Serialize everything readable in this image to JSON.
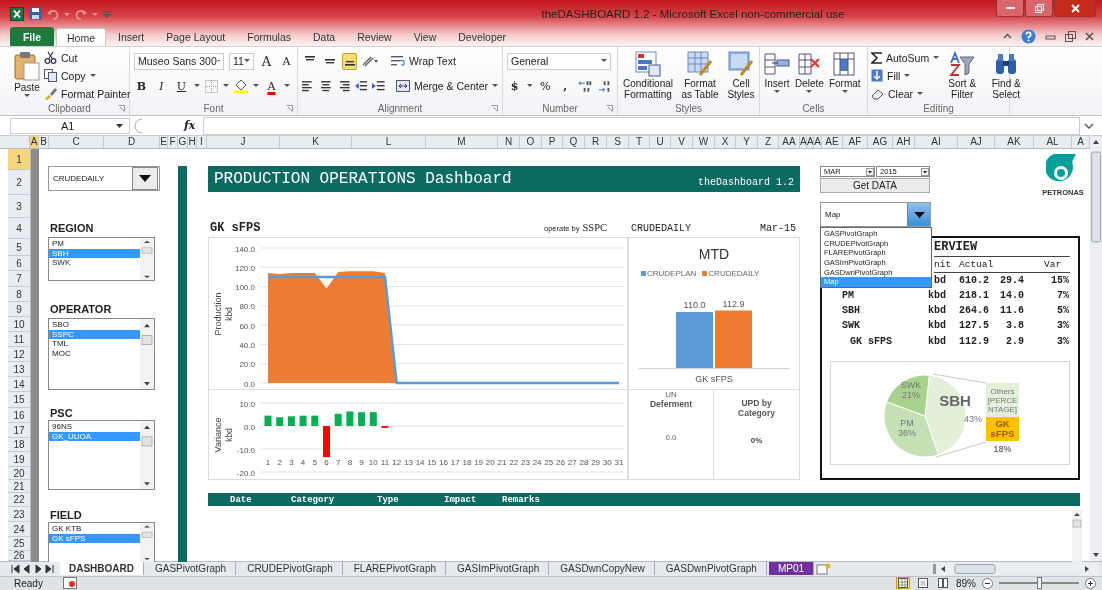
{
  "window": {
    "title": "theDASHBOARD 1.2  -  Microsoft Excel non-commercial use"
  },
  "ribbon_tabs": [
    {
      "label": "File",
      "kind": "file",
      "selected": false
    },
    {
      "label": "Home",
      "kind": "tab",
      "selected": true
    },
    {
      "label": "Insert",
      "kind": "tab",
      "selected": false
    },
    {
      "label": "Page Layout",
      "kind": "tab",
      "selected": false
    },
    {
      "label": "Formulas",
      "kind": "tab",
      "selected": false
    },
    {
      "label": "Data",
      "kind": "tab",
      "selected": false
    },
    {
      "label": "Review",
      "kind": "tab",
      "selected": false
    },
    {
      "label": "View",
      "kind": "tab",
      "selected": false
    },
    {
      "label": "Developer",
      "kind": "tab",
      "selected": false
    }
  ],
  "clipboard": {
    "group": "Clipboard",
    "paste": "Paste",
    "cut": "Cut",
    "copy": "Copy",
    "format_painter": "Format Painter"
  },
  "font": {
    "group": "Font",
    "name": "Museo Sans 300",
    "size": "11",
    "grow": "A",
    "shrink": "A",
    "bold": "B",
    "italic": "I",
    "underline": "U",
    "font_color": "A"
  },
  "alignment": {
    "group": "Alignment",
    "wrap": "Wrap Text",
    "merge": "Merge & Center",
    "vertical": [
      {
        "kind": "top",
        "on": false
      },
      {
        "kind": "middle",
        "on": false
      },
      {
        "kind": "bottom",
        "on": true
      }
    ]
  },
  "number": {
    "group": "Number",
    "format": "General",
    "currency": "$",
    "percent": "%",
    "comma": ","
  },
  "styles": {
    "group": "Styles",
    "buttons": [
      {
        "kind": "conditional",
        "label": "Conditional Formatting"
      },
      {
        "kind": "table",
        "label": "Format as Table"
      },
      {
        "kind": "cell",
        "label": "Cell Styles"
      }
    ]
  },
  "cells": {
    "group": "Cells",
    "buttons": [
      {
        "kind": "insert",
        "label": "Insert"
      },
      {
        "kind": "delete",
        "label": "Delete"
      },
      {
        "kind": "format",
        "label": "Format"
      }
    ]
  },
  "editing": {
    "group": "Editing",
    "autosum": "AutoSum",
    "fill": "Fill",
    "clear": "Clear",
    "sort": "Sort & Filter",
    "find": "Find & Select"
  },
  "formula_bar": {
    "name_box": "A1",
    "function_label": "fx"
  },
  "columns": [
    {
      "label": "A",
      "active": true
    },
    {
      "label": "B",
      "active": false
    },
    {
      "label": "C",
      "active": false
    },
    {
      "label": "D",
      "active": false
    },
    {
      "label": "E",
      "active": false
    },
    {
      "label": "F",
      "active": false
    },
    {
      "label": "G",
      "active": false
    },
    {
      "label": "H",
      "active": false
    },
    {
      "label": "I",
      "active": false
    },
    {
      "label": "J",
      "active": false
    },
    {
      "label": "K",
      "active": false
    },
    {
      "label": "L",
      "active": false
    },
    {
      "label": "M",
      "active": false
    },
    {
      "label": "N",
      "active": false
    },
    {
      "label": "O",
      "active": false
    },
    {
      "label": "P",
      "active": false
    },
    {
      "label": "Q",
      "active": false
    },
    {
      "label": "R",
      "active": false
    },
    {
      "label": "S",
      "active": false
    },
    {
      "label": "T",
      "active": false
    },
    {
      "label": "U",
      "active": false
    },
    {
      "label": "V",
      "active": false
    },
    {
      "label": "W",
      "active": false
    },
    {
      "label": "X",
      "active": false
    },
    {
      "label": "Y",
      "active": false
    },
    {
      "label": "Z",
      "active": false
    },
    {
      "label": "AA",
      "active": false
    },
    {
      "label": "A",
      "active": false
    },
    {
      "label": "A",
      "active": false
    },
    {
      "label": "A",
      "active": false
    },
    {
      "label": "AE",
      "active": false
    },
    {
      "label": "AF",
      "active": false
    },
    {
      "label": "AG",
      "active": false
    },
    {
      "label": "AH",
      "active": false
    },
    {
      "label": "AI",
      "active": false
    },
    {
      "label": "AJ",
      "active": false
    },
    {
      "label": "AK",
      "active": false
    },
    {
      "label": "AL",
      "active": false
    },
    {
      "label": "A",
      "active": false
    }
  ],
  "rows": [
    {
      "label": "1",
      "active": true
    },
    {
      "label": "2",
      "active": false
    },
    {
      "label": "3",
      "active": false
    },
    {
      "label": "4",
      "active": false
    },
    {
      "label": "5",
      "active": false
    },
    {
      "label": "6",
      "active": false
    },
    {
      "label": "7",
      "active": false
    },
    {
      "label": "8",
      "active": false
    },
    {
      "label": "9",
      "active": false
    },
    {
      "label": "10",
      "active": false
    },
    {
      "label": "11",
      "active": false
    },
    {
      "label": "12",
      "active": false
    },
    {
      "label": "13",
      "active": false
    },
    {
      "label": "14",
      "active": false
    },
    {
      "label": "15",
      "active": false
    },
    {
      "label": "16",
      "active": false
    },
    {
      "label": "17",
      "active": false
    },
    {
      "label": "18",
      "active": false
    },
    {
      "label": "19",
      "active": false
    },
    {
      "label": "20",
      "active": false
    },
    {
      "label": "21",
      "active": false
    },
    {
      "label": "22",
      "active": false
    },
    {
      "label": "23",
      "active": false
    },
    {
      "label": "24",
      "active": false
    },
    {
      "label": "25",
      "active": false
    },
    {
      "label": "26",
      "active": false
    }
  ],
  "sheet": {
    "selector": {
      "value": "CRUDEDAILY"
    },
    "filters": [
      {
        "label": "REGION",
        "items": [
          {
            "label": "PM",
            "selected": false
          },
          {
            "label": "SBH",
            "selected": true
          },
          {
            "label": "SWK",
            "selected": false
          }
        ]
      },
      {
        "label": "OPERATOR",
        "items": [
          {
            "label": "SBO",
            "selected": false
          },
          {
            "label": "SSPC",
            "selected": true
          },
          {
            "label": "TML",
            "selected": false
          },
          {
            "label": "MOC",
            "selected": false
          }
        ]
      },
      {
        "label": "PSC",
        "items": [
          {
            "label": "96NS",
            "selected": false
          },
          {
            "label": "GK_UUOA",
            "selected": true
          }
        ]
      },
      {
        "label": "FIELD",
        "items": [
          {
            "label": "GK KTB",
            "selected": false
          },
          {
            "label": "GK sFPS",
            "selected": true
          }
        ]
      }
    ],
    "banner": {
      "title": "PRODUCTION OPERATIONS Dashboard",
      "version": "theDashboard 1.2"
    },
    "field_title": "GK sFPS",
    "operator_label": "operate by",
    "operator": "SSPC",
    "measure": "CRUDEDAILY",
    "period": "Mar-15",
    "production_chart": {
      "unit": "kbd",
      "chart_data": {
        "type": "area",
        "ylabel": "Production",
        "ylim": [
          0,
          140
        ],
        "grid": true,
        "yticks": [
          {
            "value": 0,
            "label": "0.0"
          },
          {
            "value": 20,
            "label": "20.0"
          },
          {
            "value": 40,
            "label": "40.0"
          },
          {
            "value": 60,
            "label": "60.0"
          },
          {
            "value": 80,
            "label": "80.0"
          },
          {
            "value": 100,
            "label": "100.0"
          },
          {
            "value": 120,
            "label": "120.0"
          },
          {
            "value": 140,
            "label": "140.0"
          }
        ],
        "series": [
          {
            "type": "area",
            "color": "#ed7d31",
            "values": [
              114,
              113,
              114,
              114,
              114,
              98,
              115,
              116,
              116,
              116,
              114,
              0,
              0,
              0,
              0,
              0,
              0,
              0,
              0,
              0,
              0,
              0,
              0,
              0,
              0,
              0,
              0,
              0,
              0,
              0,
              0
            ]
          },
          {
            "type": "line",
            "color": "#5b9bd5",
            "values": [
              110,
              110,
              110,
              110,
              110,
              110,
              110,
              110,
              110,
              110,
              110,
              0,
              0,
              0,
              0,
              0,
              0,
              0,
              0,
              0,
              0,
              0,
              0,
              0,
              0,
              0,
              0,
              0,
              0,
              0,
              0
            ]
          }
        ]
      }
    },
    "variance_chart": {
      "unit": "kbd",
      "chart_data": {
        "type": "bar",
        "ylabel": "Variance",
        "stacked": true,
        "grid": true,
        "x": [
          1,
          2,
          3,
          4,
          5,
          6,
          7,
          8,
          9,
          10,
          11,
          12,
          13,
          14,
          15,
          16,
          17,
          18,
          19,
          20,
          21,
          22,
          23,
          24,
          25,
          26,
          27,
          28,
          29,
          30,
          31
        ],
        "ylim": [
          -20,
          10
        ],
        "yticks": [
          {
            "value": -20,
            "label": "-20.0"
          },
          {
            "value": -10,
            "label": "-10.0"
          },
          {
            "value": 0,
            "label": "0.0"
          },
          {
            "value": 10,
            "label": "10.0"
          }
        ],
        "series": [
          {
            "color": "#00b050",
            "values": [
              4.5,
              3.8,
              4.2,
              4.5,
              4.5,
              null,
              5.3,
              6.3,
              6,
              6,
              null,
              null,
              null,
              null,
              null,
              null,
              null,
              null,
              null,
              null,
              null,
              null,
              null,
              null,
              null,
              null,
              null,
              null,
              null,
              null,
              null
            ]
          },
          {
            "color": "#ff0000",
            "values": [
              null,
              null,
              null,
              null,
              null,
              -13.5,
              null,
              null,
              null,
              null,
              -0.8,
              null,
              null,
              null,
              null,
              null,
              null,
              null,
              null,
              null,
              null,
              null,
              null,
              null,
              null,
              null,
              null,
              null,
              null,
              null,
              null
            ]
          }
        ]
      }
    },
    "mtd_chart": {
      "chart_data": {
        "type": "bar",
        "title": "MTD",
        "categories": [
          "GK sFPS"
        ],
        "series": [
          {
            "name": "CRUDEPLAN",
            "color": "#5b9bd5",
            "values": [
              110.0
            ],
            "value_labels": [
              "110.0"
            ]
          },
          {
            "name": "CRUDEDAILY",
            "color": "#ed7d31",
            "values": [
              112.9
            ],
            "value_labels": [
              "112.9"
            ]
          }
        ]
      }
    },
    "deferment": {
      "title": "Deferment",
      "caption": "UN",
      "value": "0.0"
    },
    "upd": {
      "title": "UPD by Category",
      "value": "0%"
    },
    "period_selector": {
      "month": "MAR",
      "year": "2015",
      "button": "Get DATA"
    },
    "graph_selector": {
      "value": "Map",
      "expanded": true,
      "options": [
        {
          "label": "GASPivotGraph",
          "selected": false
        },
        {
          "label": "CRUDEPivotGraph",
          "selected": false
        },
        {
          "label": "FLAREPivotGraph",
          "selected": false
        },
        {
          "label": "GASImPivotGraph",
          "selected": false
        },
        {
          "label": "GASDwnPivotGraph",
          "selected": false
        },
        {
          "label": "Map",
          "selected": true
        }
      ]
    },
    "logo": {
      "text": "PETRONAS"
    },
    "overview": {
      "title": "ERVIEW",
      "columns": [
        "nit",
        "Actual",
        "Var"
      ],
      "rows": [
        {
          "unit": "bd",
          "actual": "610.2",
          "change": "29.4",
          "var": "15%",
          "children": [
            {
              "label": "PM",
              "unit": "kbd",
              "actual": "218.1",
              "change": "14.0",
              "var": "7%"
            },
            {
              "label": "SBH",
              "unit": "kbd",
              "actual": "264.6",
              "change": "11.6",
              "var": "5%"
            },
            {
              "label": "SWK",
              "unit": "kbd",
              "actual": "127.5",
              "change": "3.8",
              "var": "3%",
              "children": [
                {
                  "label": "GK sFPS",
                  "unit": "kbd",
                  "actual": "112.9",
                  "change": "2.9",
                  "var": "3%"
                }
              ]
            }
          ]
        }
      ],
      "pie": {
        "chart_data": {
          "type": "pie",
          "categories": [
            "SBH",
            "PM",
            "SWK"
          ],
          "value_labels": [
            "43%",
            "36%",
            "21%"
          ],
          "series": [
            {
              "values": [
                43,
                36,
                21
              ],
              "colors": [
                "#e2efd9",
                "#c5e0b4",
                "#a9d18e"
              ]
            }
          ]
        },
        "secondary": [
          {
            "label": "Others [PERCENTAGE]",
            "color": "#e2efd9"
          },
          {
            "label": "GK sFPS",
            "value_label": "18%",
            "color": "#ffc000"
          }
        ]
      }
    },
    "events_table": {
      "columns": [
        "Date",
        "Category",
        "Type",
        "Impact",
        "Remarks"
      ]
    }
  },
  "sheet_tabs": [
    {
      "label": "DASHBOARD",
      "selected": true
    },
    {
      "label": "GASPivotGraph",
      "selected": false
    },
    {
      "label": "CRUDEPivotGraph",
      "selected": false
    },
    {
      "label": "FLAREPivotGraph",
      "selected": false
    },
    {
      "label": "GASImPivotGraph",
      "selected": false
    },
    {
      "label": "GASDwnCopyNew",
      "selected": false
    },
    {
      "label": "GASDwnPivotGraph",
      "selected": false
    },
    {
      "label": "MP01",
      "selected": false,
      "color": "#7030a0"
    }
  ],
  "status_bar": {
    "text": "Ready",
    "views": [
      {
        "kind": "normal",
        "selected": true
      },
      {
        "kind": "layout",
        "selected": false
      },
      {
        "kind": "break",
        "selected": false
      }
    ],
    "zoom": "89%",
    "zoom_slider": {
      "level": 0.5
    }
  }
}
